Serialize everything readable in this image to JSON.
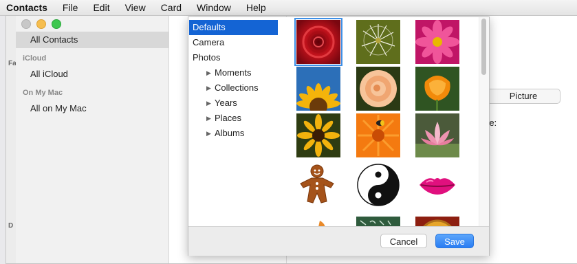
{
  "menubar": {
    "items": [
      "Contacts",
      "File",
      "Edit",
      "View",
      "Card",
      "Window",
      "Help"
    ]
  },
  "sidebar": {
    "all_contacts": "All Contacts",
    "icloud_header": "iCloud",
    "all_icloud": "All iCloud",
    "onmymac_header": "On My Mac",
    "all_on_my_mac": "All on My Mac"
  },
  "background": {
    "picture_label": "Picture",
    "frag_re": "re:",
    "strip_frag_top": "Fa",
    "strip_frag_bottom": "D"
  },
  "picker": {
    "sources": [
      {
        "label": "Defaults",
        "selected": true,
        "sub": false
      },
      {
        "label": "Camera",
        "selected": false,
        "sub": false
      },
      {
        "label": "Photos",
        "selected": false,
        "sub": false
      },
      {
        "label": "Moments",
        "selected": false,
        "sub": true
      },
      {
        "label": "Collections",
        "selected": false,
        "sub": true
      },
      {
        "label": "Years",
        "selected": false,
        "sub": true
      },
      {
        "label": "Places",
        "selected": false,
        "sub": true
      },
      {
        "label": "Albums",
        "selected": false,
        "sub": true
      }
    ],
    "images": [
      {
        "name": "red-rose",
        "selected": true
      },
      {
        "name": "dandelion",
        "selected": false
      },
      {
        "name": "pink-dahlia",
        "selected": false
      },
      {
        "name": "sunflower",
        "selected": false
      },
      {
        "name": "peach-rose",
        "selected": false
      },
      {
        "name": "orange-poppy",
        "selected": false
      },
      {
        "name": "black-eyed-daisy",
        "selected": false
      },
      {
        "name": "orange-gerbera-bee",
        "selected": false
      },
      {
        "name": "pink-lotus",
        "selected": false
      },
      {
        "name": "gingerbread-man",
        "selected": false
      },
      {
        "name": "yin-yang",
        "selected": false
      },
      {
        "name": "lips",
        "selected": false
      },
      {
        "name": "partial-orange",
        "selected": false
      },
      {
        "name": "partial-chalkboard",
        "selected": false
      },
      {
        "name": "partial-coin",
        "selected": false
      }
    ],
    "cancel_label": "Cancel",
    "save_label": "Save",
    "colors": {
      "selection": "#1464d4",
      "accent": "#2a7df3"
    }
  }
}
